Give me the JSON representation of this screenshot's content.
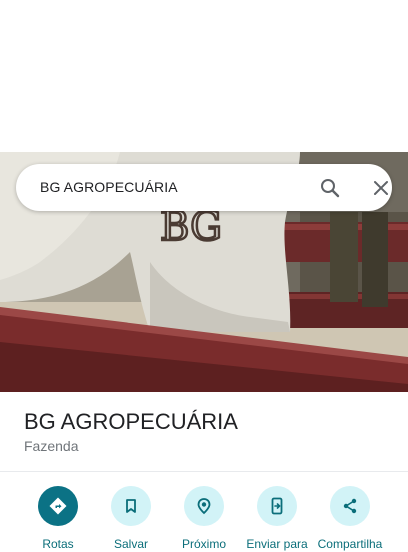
{
  "search": {
    "query": "BG AGROPECUÁRIA",
    "search_icon": "search-icon",
    "close_icon": "close-icon"
  },
  "photo": {
    "brand_text": "BG"
  },
  "place": {
    "title": "BG AGROPECUÁRIA",
    "category": "Fazenda"
  },
  "actions": [
    {
      "label": "Rotas",
      "icon": "directions-icon"
    },
    {
      "label": "Salvar",
      "icon": "bookmark-icon"
    },
    {
      "label": "Próximo",
      "icon": "nearby-icon"
    },
    {
      "label": "Enviar para",
      "icon": "send-to-phone-icon"
    },
    {
      "label": "Compartilha",
      "icon": "share-icon"
    }
  ],
  "colors": {
    "accent": "#0b7285",
    "accent_light": "#d2f3f7",
    "text_primary": "#202124",
    "text_secondary": "#70757a"
  }
}
